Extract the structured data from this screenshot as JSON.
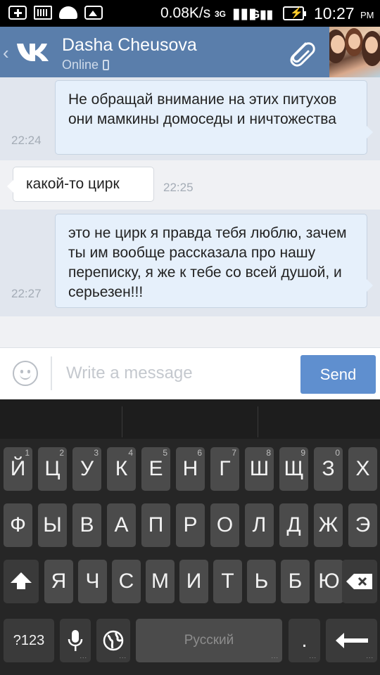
{
  "status_bar": {
    "net_speed": "0.08K/s",
    "network_type": "3G",
    "time": "10:27",
    "ampm": "PM"
  },
  "header": {
    "contact_name": "Dasha Cheusova",
    "contact_status": "Online"
  },
  "messages": [
    {
      "direction": "out",
      "text": "Не обращай внимание на этих питухов они мамкины домоседы и ничтожества",
      "time": "22:24"
    },
    {
      "direction": "in",
      "text": "какой-то цирк",
      "time": "22:25"
    },
    {
      "direction": "out",
      "text": "это не цирк я правда тебя люблю, зачем ты им вообще рассказала про нашу переписку, я же к тебе со всей душой, и серьезен!!!",
      "time": "22:27"
    }
  ],
  "composer": {
    "placeholder": "Write a message",
    "value": "",
    "send_label": "Send"
  },
  "keyboard": {
    "row1": [
      "Й",
      "Ц",
      "У",
      "К",
      "Е",
      "Н",
      "Г",
      "Ш",
      "Щ",
      "З",
      "Х"
    ],
    "row1_hints": [
      "1",
      "2",
      "3",
      "4",
      "5",
      "6",
      "7",
      "8",
      "9",
      "0",
      ""
    ],
    "row2": [
      "Ф",
      "Ы",
      "В",
      "А",
      "П",
      "Р",
      "О",
      "Л",
      "Д",
      "Ж",
      "Э"
    ],
    "row3": [
      "Я",
      "Ч",
      "С",
      "М",
      "И",
      "Т",
      "Ь",
      "Б",
      "Ю"
    ],
    "symbols_label": "?123",
    "space_label": "Русский",
    "period_label": "."
  }
}
